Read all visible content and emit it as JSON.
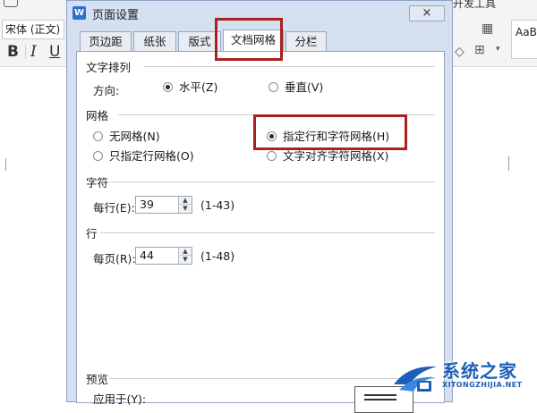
{
  "app": {
    "font_name": "宋体 (正文)",
    "bold_label": "B",
    "italic_label": "I",
    "underline_label": "U",
    "right_top_label": "开发工具",
    "style_preview": "AaB"
  },
  "dialog": {
    "title": "页面设置",
    "logo_letter": "W",
    "close_label": "×",
    "tabs": [
      {
        "label": "页边距"
      },
      {
        "label": "纸张"
      },
      {
        "label": "版式"
      },
      {
        "label": "文档网格",
        "active": true
      },
      {
        "label": "分栏"
      }
    ],
    "text_direction": {
      "section_label": "文字排列",
      "direction_label": "方向:",
      "options": [
        {
          "label": "水平(Z)",
          "checked": true
        },
        {
          "label": "垂直(V)",
          "checked": false
        }
      ]
    },
    "grid": {
      "section_label": "网格",
      "options": [
        {
          "label": "无网格(N)",
          "checked": false
        },
        {
          "label": "指定行和字符网格(H)",
          "checked": true
        },
        {
          "label": "只指定行网格(O)",
          "checked": false
        },
        {
          "label": "文字对齐字符网格(X)",
          "checked": false
        }
      ]
    },
    "chars": {
      "section_label": "字符",
      "field_label": "每行(E):",
      "value": "39",
      "range": "(1-43)"
    },
    "lines": {
      "section_label": "行",
      "field_label": "每页(R):",
      "value": "44",
      "range": "(1-48)"
    },
    "preview": {
      "section_label": "预览",
      "apply_to_label": "应用于(Y):"
    }
  },
  "watermark": {
    "title": "系统之家",
    "url": "XITONGZHIJIA.NET"
  },
  "colors": {
    "highlight_border": "#a9221f",
    "dialog_bg": "#d4dff0",
    "watermark_blue": "#1d5fb8"
  }
}
